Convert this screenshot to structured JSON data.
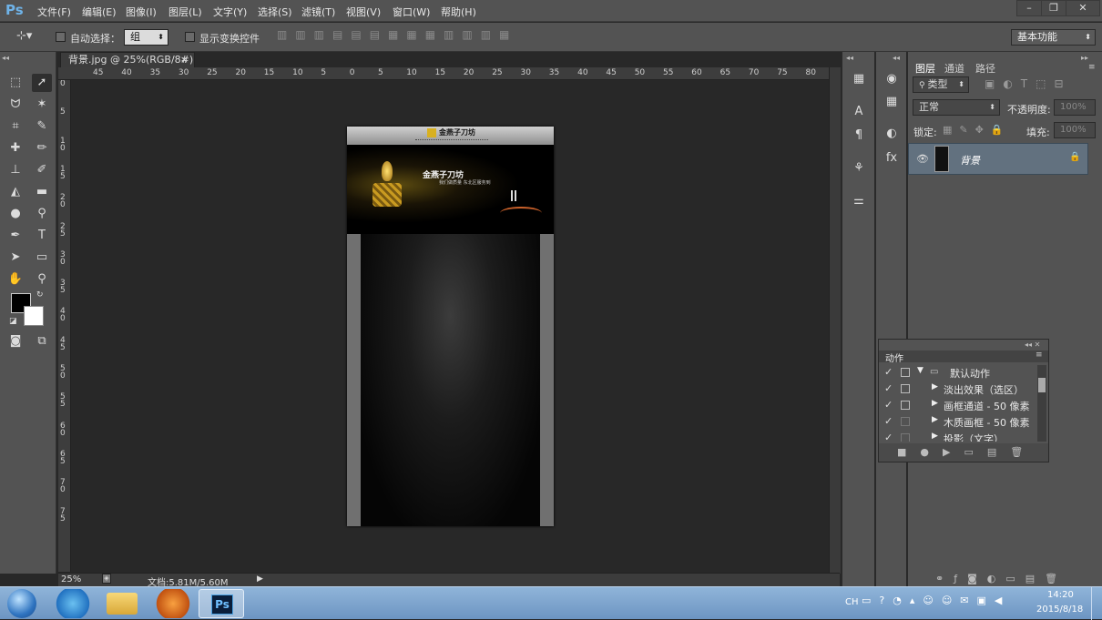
{
  "app": {
    "logo": "Ps",
    "menus": [
      "文件(F)",
      "编辑(E)",
      "图像(I)",
      "图层(L)",
      "文字(Y)",
      "选择(S)",
      "滤镜(T)",
      "视图(V)",
      "窗口(W)",
      "帮助(H)"
    ],
    "window_buttons": [
      "–",
      "❐",
      "✕"
    ]
  },
  "options": {
    "auto_select_label": "自动选择：",
    "auto_select_value": "组",
    "show_transform_label": "显示变换控件",
    "workspace": "基本功能"
  },
  "document": {
    "tab_title": "背景.jpg @ 25%(RGB/8#)",
    "tab_close": "×",
    "ruler_top": [
      "45",
      "40",
      "35",
      "30",
      "25",
      "20",
      "15",
      "10",
      "5",
      "0",
      "5",
      "10",
      "15",
      "20",
      "25",
      "30",
      "35",
      "40",
      "45",
      "50",
      "55",
      "60",
      "65",
      "70",
      "75",
      "80"
    ],
    "ruler_left": [
      "0",
      "5",
      "1 0",
      "1 5",
      "2 0",
      "2 5",
      "3 0",
      "3 5",
      "4 0",
      "4 5",
      "5 0",
      "5 5",
      "6 0",
      "6 5",
      "7 0",
      "7 5"
    ],
    "zoom": "25%",
    "doc_size": "文档:5.81M/5.60M",
    "brand_logo_text": "金燕子刀坊",
    "banner_title": "金燕子刀坊",
    "banner_subtitle": "我们做质量  东北区服务到"
  },
  "layers_panel": {
    "tabs": [
      "图层",
      "通道",
      "路径"
    ],
    "filter_kind": "类型",
    "blend_mode": "正常",
    "opacity_label": "不透明度:",
    "opacity_value": "100%",
    "lock_label": "锁定:",
    "fill_label": "填充:",
    "fill_value": "100%",
    "layers": [
      {
        "name": "背景",
        "locked": true,
        "visible": true
      }
    ]
  },
  "actions_panel": {
    "tab": "动作",
    "items": [
      {
        "checked": true,
        "folder": true,
        "label": "默认动作"
      },
      {
        "checked": true,
        "folder": false,
        "label": "淡出效果（选区）"
      },
      {
        "checked": true,
        "folder": false,
        "label": "画框通道 - 50 像素"
      },
      {
        "checked": true,
        "folder": false,
        "label": "木质画框 - 50 像素"
      },
      {
        "checked": true,
        "folder": false,
        "label": "投影（文字）"
      }
    ]
  },
  "taskbar": {
    "lang": "CH",
    "time": "14:20",
    "date": "2015/8/18"
  }
}
